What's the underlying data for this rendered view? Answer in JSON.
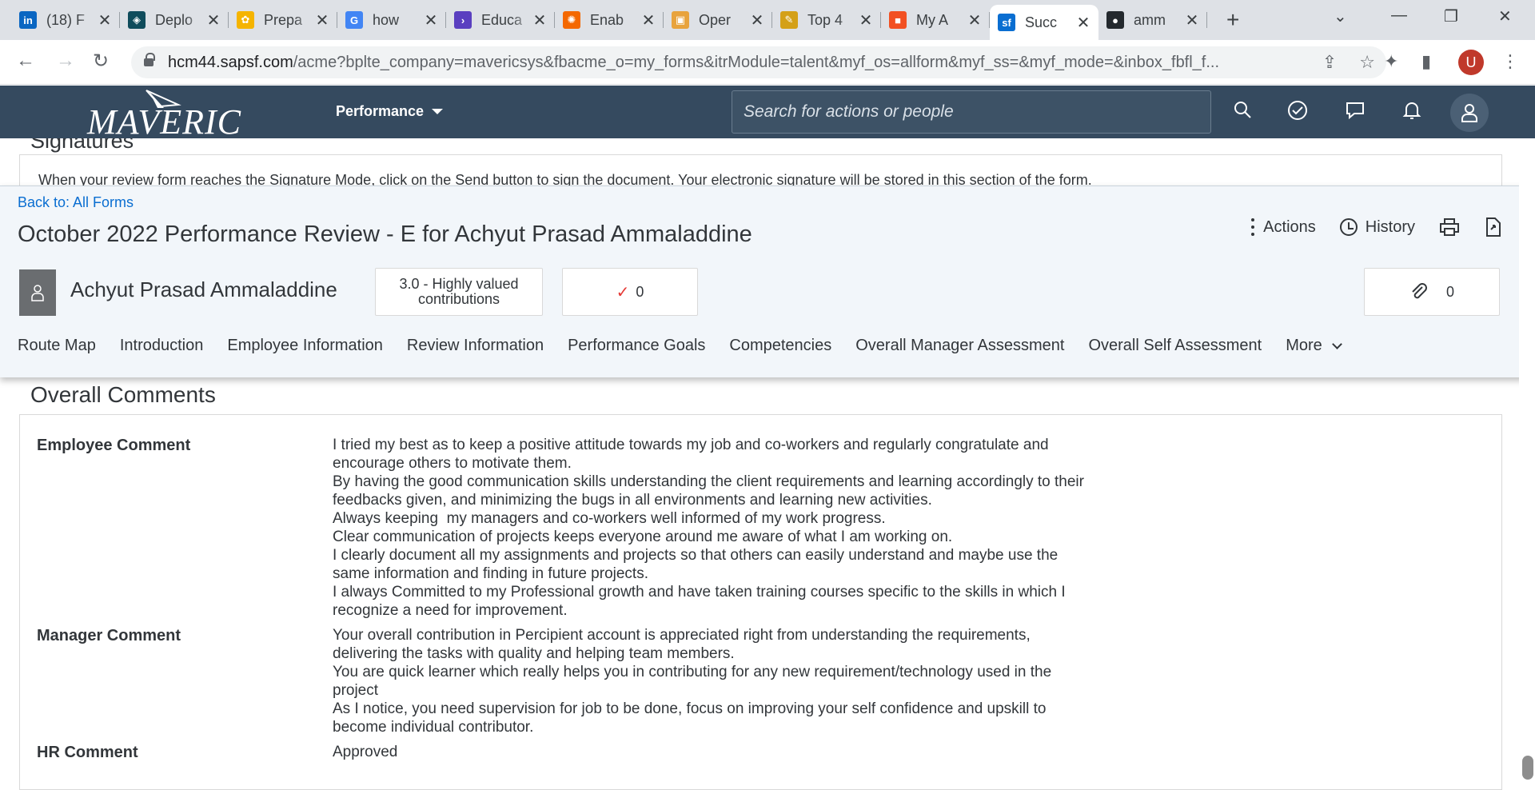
{
  "browser": {
    "tabs": [
      {
        "title": "(18) F",
        "favicon": "linkedin-icon",
        "color": "#0a66c2",
        "glyph": "in"
      },
      {
        "title": "Deplo",
        "favicon": "deploy-icon",
        "color": "#0f4c5c",
        "glyph": "◈"
      },
      {
        "title": "Prepa",
        "favicon": "prepare-icon",
        "color": "#f5b400",
        "glyph": "✿"
      },
      {
        "title": "how",
        "favicon": "google-icon",
        "color": "#4285f4",
        "glyph": "G"
      },
      {
        "title": "Educa",
        "favicon": "terminal-icon",
        "color": "#5a3fc0",
        "glyph": "›"
      },
      {
        "title": "Enab",
        "favicon": "grafana-icon",
        "color": "#f46800",
        "glyph": "✺"
      },
      {
        "title": "Oper",
        "favicon": "box-icon",
        "color": "#e8a33d",
        "glyph": "▣"
      },
      {
        "title": "Top 4",
        "favicon": "pencil-icon",
        "color": "#d4a017",
        "glyph": "✎"
      },
      {
        "title": "My A",
        "favicon": "microsoft-icon",
        "color": "#f25022",
        "glyph": "■"
      },
      {
        "title": "Succ",
        "favicon": "successfactors-icon",
        "color": "#0a6ed1",
        "glyph": "sf"
      },
      {
        "title": "amm",
        "favicon": "github-icon",
        "color": "#24292e",
        "glyph": "●"
      }
    ],
    "active_tab_index": 9,
    "url_domain": "hcm44.sapsf.com",
    "url_rest": "/acme?bplte_company=mavericsys&fbacme_o=my_forms&itrModule=talent&myf_os=allform&myf_ss=&myf_mode=&inbox_fbfl_f...",
    "profile_initial": "U"
  },
  "shell": {
    "logo_text": "MAVERIC",
    "menu_label": "Performance",
    "search_placeholder": "Search for actions or people"
  },
  "background": {
    "signature_title": "Signatures",
    "signature_text": "When your review form reaches the Signature Mode, click on the Send button to sign the document. Your electronic signature will be stored in this section of the form."
  },
  "form": {
    "back_link": "Back to: All Forms",
    "title": "October 2022 Performance Review - E for Achyut Prasad Ammaladdine",
    "actions_label": "Actions",
    "history_label": "History",
    "person_name": "Achyut Prasad Ammaladdine",
    "rating": "3.0 - Highly valued contributions",
    "check_count": "0",
    "attach_count": "0",
    "sections": [
      "Route Map",
      "Introduction",
      "Employee Information",
      "Review Information",
      "Performance Goals",
      "Competencies",
      "Overall Manager Assessment",
      "Overall Self Assessment"
    ],
    "more_label": "More"
  },
  "overall_comments": {
    "title": "Overall Comments",
    "employee_label": "Employee Comment",
    "employee_lines": [
      "I tried my best as to keep a positive attitude towards my job and co-workers and regularly congratulate and encourage others to motivate them.",
      "By having the good communication skills understanding the client requirements and learning accordingly to their feedbacks given, and minimizing the bugs in all environments and learning new activities.",
      "Always keeping  my managers and co-workers well informed of my work progress.",
      "Clear communication of projects keeps everyone around me aware of what I am working on.",
      "I clearly document all my assignments and projects so that others can easily understand and maybe use the same information and finding in future projects.",
      "I always Committed to my Professional growth and have taken training courses specific to the skills in which I recognize a need for improvement."
    ],
    "manager_label": "Manager Comment",
    "manager_lines": [
      "Your overall contribution in Percipient account is appreciated right from understanding the requirements, delivering the tasks with quality and helping team members.",
      "You are quick learner which really helps you in contributing for any new requirement/technology used in the project",
      "As I notice, you need supervision for job to be done, focus on improving your self confidence and upskill to become individual contributor."
    ],
    "hr_label": "HR Comment",
    "hr_text": "Approved"
  }
}
